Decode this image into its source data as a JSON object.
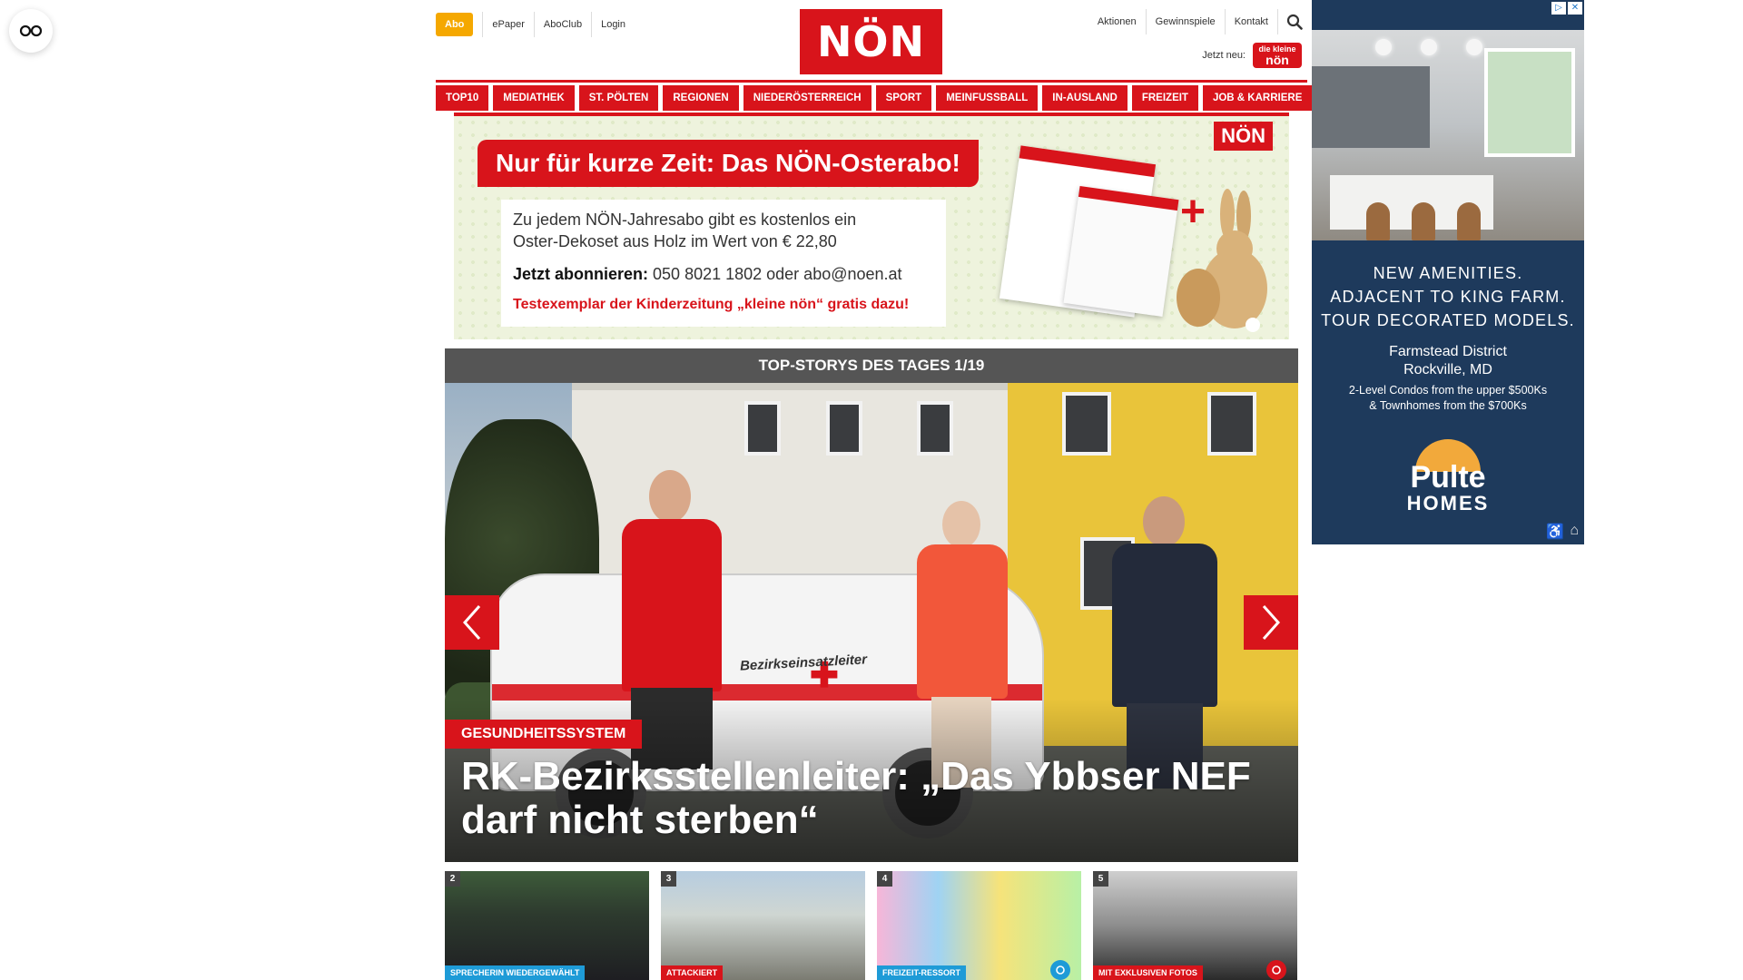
{
  "header": {
    "abo_label": "Abo",
    "top_links": [
      "ePaper",
      "AboClub",
      "Login"
    ],
    "logo_text": "NÖN",
    "right_links": [
      "Aktionen",
      "Gewinnspiele",
      "Kontakt"
    ],
    "jetzt_label": "Jetzt neu:",
    "kleine_badge_top": "die kleine",
    "kleine_badge_main": "nön"
  },
  "nav": {
    "items": [
      "TOP10",
      "MEDIATHEK",
      "ST. PÖLTEN",
      "REGIONEN",
      "NIEDERÖSTERREICH",
      "SPORT",
      "MEINFUSSBALL",
      "IN-AUSLAND",
      "FREIZEIT",
      "JOB & KARRIERE"
    ]
  },
  "promo": {
    "title": "Nur für kurze Zeit: Das NÖN-Osterabo!",
    "text": "Zu jedem NÖN-Jahresabo gibt es kostenlos ein Oster-Dekoset aus Holz im Wert von € 22,80",
    "contact_bold": "Jetzt abonnieren:",
    "contact_rest": " 050 8021 1802 oder abo@noen.at",
    "highlight": "Testexemplar der Kinderzeitung „kleine nön“ gratis dazu!",
    "logo": "NÖN"
  },
  "carousel": {
    "bar_title": "TOP-STORYS DES TAGES 1/19",
    "category": "GESUNDHEITSSYSTEM",
    "headline": "RK-Bezirksstellenleiter: „Das Ybbser NEF darf nicht sterben“",
    "car_text": "Bezirkseinsatzleiter"
  },
  "thumbs": [
    {
      "num": "2",
      "tag": "SPRECHERIN WIEDERGEWÄHLT",
      "tag_color": "#1e9bd7"
    },
    {
      "num": "3",
      "tag": "ATTACKIERT",
      "tag_color": "#d8141b"
    },
    {
      "num": "4",
      "tag": "FREIZEIT-RESSORT",
      "tag_color": "#1e9bd7",
      "badge_color": "#1e9bd7"
    },
    {
      "num": "5",
      "tag": "MIT EXKLUSIVEN FOTOS",
      "tag_color": "#d8141b",
      "badge_color": "#d8141b"
    }
  ],
  "ad": {
    "headline_lines": [
      "NEW AMENITIES.",
      "ADJACENT TO KING FARM.",
      "TOUR DECORATED MODELS."
    ],
    "location_lines": [
      "Farmstead District",
      "Rockville, MD"
    ],
    "pricing_lines": [
      "2-Level Condos from the upper $500Ks",
      "& Townhomes from the $700Ks"
    ],
    "brand_name": "Pulte",
    "brand_sub": "HOMES",
    "choices": [
      "▷",
      "✕"
    ]
  },
  "colors": {
    "brand_red": "#d8141b",
    "abo_orange": "#f5a800",
    "carousel_bar": "#555555",
    "ad_blue": "#1e3a5c"
  }
}
